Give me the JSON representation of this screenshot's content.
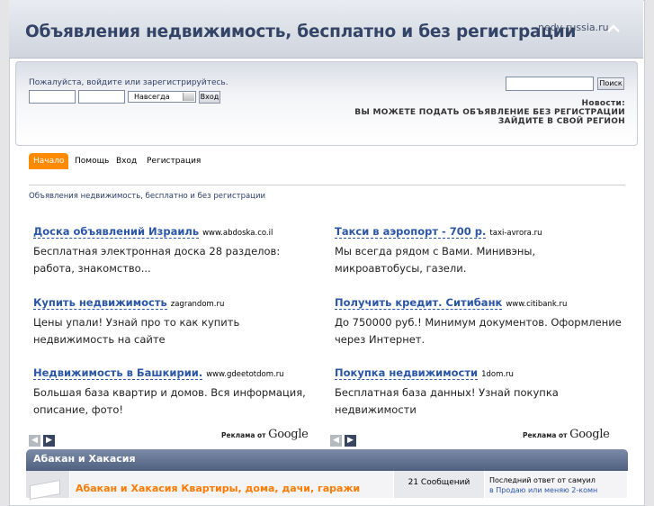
{
  "header": {
    "title": "Объявления недвижимость, бесплатно и без регистрации",
    "domain": "nedv-russia.ru"
  },
  "login": {
    "prompt": "Пожалуйста, войдите или зарегистрируйтесь.",
    "duration_selected": "Навсегда",
    "login_button": "Вход"
  },
  "search": {
    "button": "Поиск"
  },
  "news": {
    "label": "Новости:",
    "line1": "ВЫ МОЖЕТЕ ПОДАТЬ ОБЪЯВЛЕНИЕ БЕЗ РЕГИСТРАЦИИ",
    "line2": "ЗАЙДИТЕ В СВОЙ РЕГИОН"
  },
  "menu": {
    "items": [
      "Начало",
      "Помощь",
      "Вход",
      "Регистрация"
    ]
  },
  "breadcrumb": "Объявления недвижимость, бесплатно и без регистрации",
  "ads": [
    {
      "title": "Доска объявлений Израиль",
      "url": "www.abdoska.co.il",
      "text1": "Бесплатная электронная доска 28 разделов:",
      "text2": "работа, знакомство..."
    },
    {
      "title": "Такси в аэропорт - 700 р.",
      "url": "taxi-avrora.ru",
      "text1": "Мы всегда рядом с Вами. Минивэны,",
      "text2": "микроавтобусы, газели."
    },
    {
      "title": "Купить недвижимость",
      "url": "zagrandom.ru",
      "text1": "Цены упали! Узнай про то как купить",
      "text2": "недвижимость на сайте"
    },
    {
      "title": "Получить кредит. Ситибанк",
      "url": "www.citibank.ru",
      "text1": "До 750000 руб.! Минимум документов. Оформление",
      "text2": "через Интернет."
    },
    {
      "title": "Недвижимость в Башкирии.",
      "url": "www.gdeetotdom.ru",
      "text1": "Большая база квартир и домов. Вся информация,",
      "text2": "описание, фото!"
    },
    {
      "title": "Покупка недвижимости",
      "url": "1dom.ru",
      "text1": "Бесплатная база данных! Узнай покупка",
      "text2": "недвижимости"
    }
  ],
  "ads_by": {
    "prefix": "Реклама от",
    "brand": "Google"
  },
  "category": {
    "title": "Абакан и Хакасия",
    "board": {
      "name": "Абакан и Хакасия Квартиры, дома, дачи, гаражи",
      "stats": "21 Сообщений",
      "last_post_by": "Последний ответ от самуил",
      "last_post_in": "в Продаю или меняю 2-комн"
    }
  }
}
